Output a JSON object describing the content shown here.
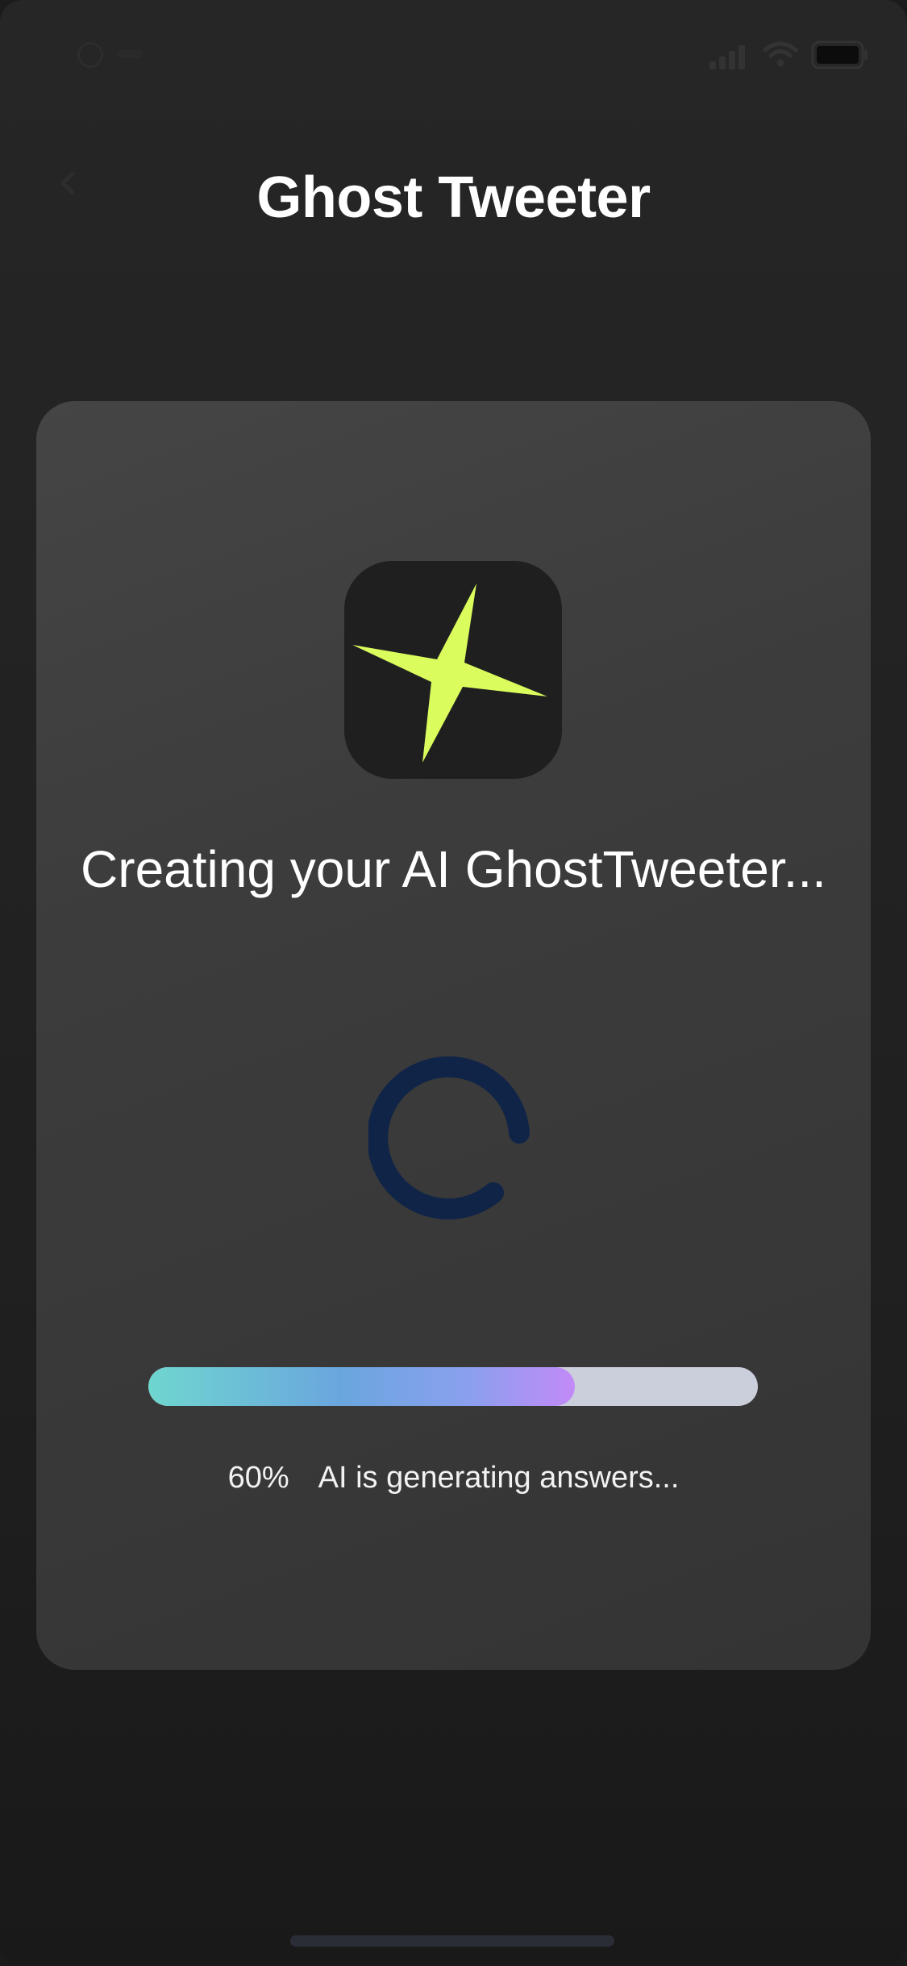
{
  "app": {
    "title": "Ghost Tweeter"
  },
  "status": {
    "heading": "Creating your AI GhostTweeter...",
    "progress_percent": 70,
    "progress_label": "60%",
    "message": "AI is generating answers..."
  },
  "icons": {
    "logo": "four-point-star-icon",
    "spinner": "loading-spinner-icon",
    "signal": "signal-icon",
    "wifi": "wifi-icon",
    "battery": "battery-icon"
  },
  "colors": {
    "background": "#1f1f1f",
    "card": "#3c3c3c",
    "star": "#dafc5c",
    "spinner": "#0f2447",
    "progress_track": "#cbcfdc",
    "progress_gradient_start": "#6fd6cf",
    "progress_gradient_end": "#c28af7"
  }
}
